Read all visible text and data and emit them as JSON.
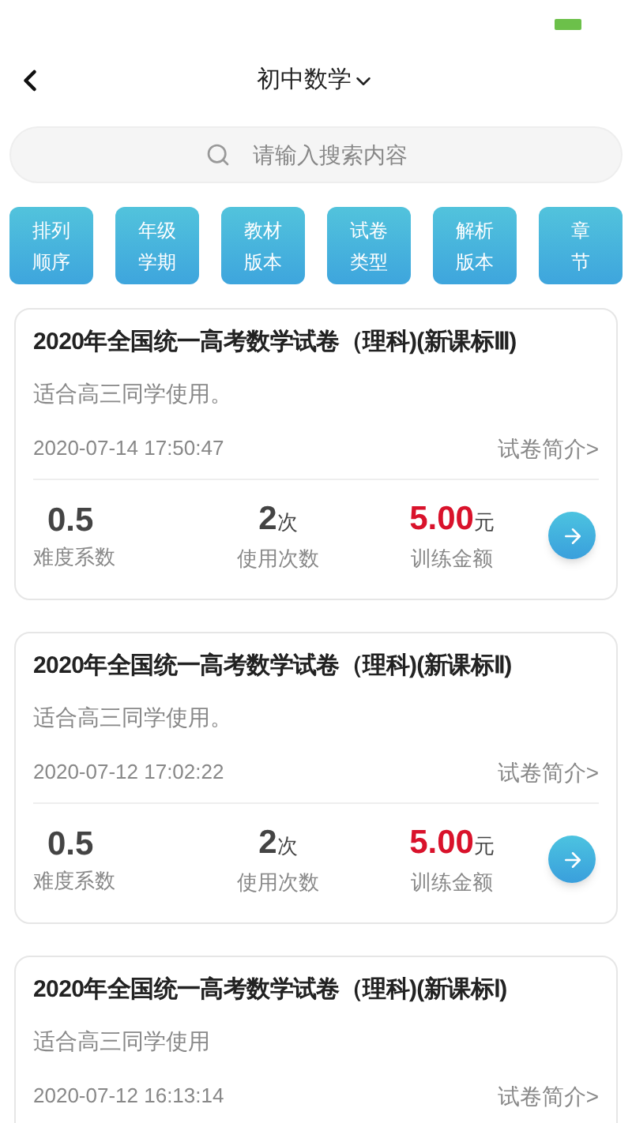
{
  "header": {
    "title": "初中数学"
  },
  "search": {
    "placeholder": "请输入搜索内容"
  },
  "filters": [
    {
      "lines": [
        "排列",
        "顺序"
      ]
    },
    {
      "lines": [
        "年级",
        "学期"
      ]
    },
    {
      "lines": [
        "教材",
        "版本"
      ]
    },
    {
      "lines": [
        "试卷",
        "类型"
      ]
    },
    {
      "lines": [
        "解析",
        "版本"
      ]
    },
    {
      "lines": [
        "章",
        "节"
      ]
    }
  ],
  "papers": [
    {
      "title": "2020年全国统一高考数学试卷（理科)(新课标Ⅲ)",
      "subtitle": "适合高三同学使用。",
      "date": "2020-07-14 17:50:47",
      "intro_link": "试卷简介>",
      "stats": {
        "difficulty": "0.5",
        "difficulty_label": "难度系数",
        "uses": "2",
        "uses_unit": "次",
        "uses_label": "使用次数",
        "price": "5.00",
        "price_unit": "元",
        "price_label": "训练金额"
      }
    },
    {
      "title": "2020年全国统一高考数学试卷（理科)(新课标Ⅱ)",
      "subtitle": "适合高三同学使用。",
      "date": "2020-07-12 17:02:22",
      "intro_link": "试卷简介>",
      "stats": {
        "difficulty": "0.5",
        "difficulty_label": "难度系数",
        "uses": "2",
        "uses_unit": "次",
        "uses_label": "使用次数",
        "price": "5.00",
        "price_unit": "元",
        "price_label": "训练金额"
      }
    },
    {
      "title": "2020年全国统一高考数学试卷（理科)(新课标Ⅰ)",
      "subtitle": "适合高三同学使用",
      "date": "2020-07-12 16:13:14",
      "intro_link": "试卷简介>"
    }
  ]
}
